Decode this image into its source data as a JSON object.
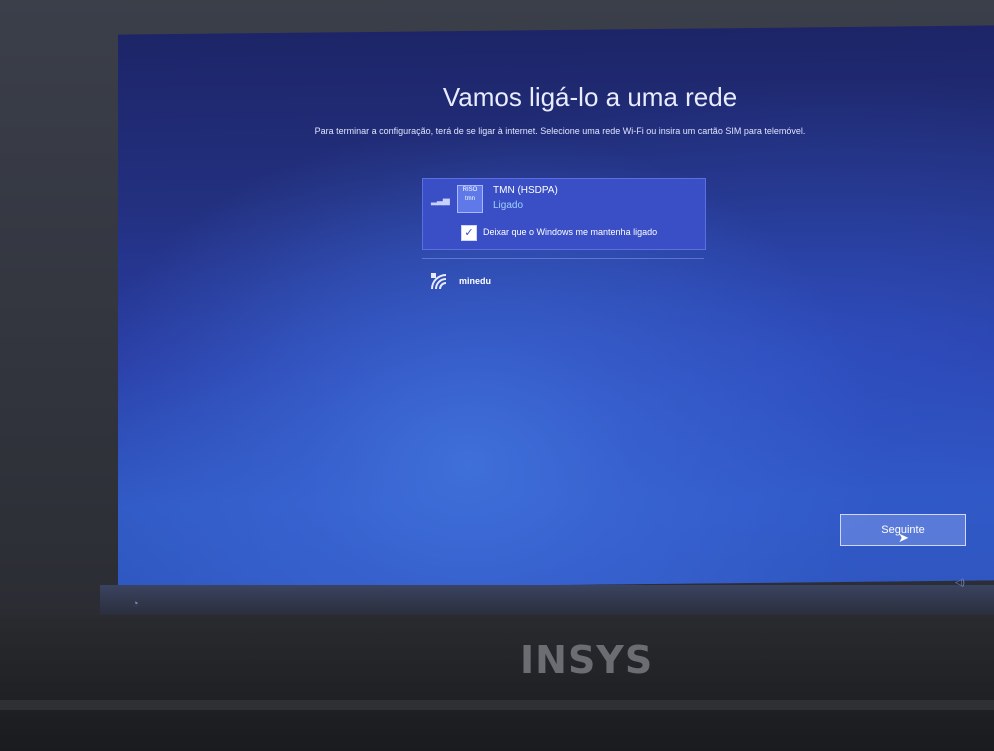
{
  "page": {
    "title": "Vamos ligá-lo a uma rede",
    "subtitle": "Para terminar a configuração, terá de se ligar à internet. Selecione uma rede Wi-Fi ou insira um cartão SIM para telemóvel."
  },
  "networks": {
    "selected": {
      "name": "TMN (HSDPA)",
      "status": "Ligado",
      "sim_label_top": "RISO",
      "sim_label_bottom": "tmn",
      "keep_connected_label": "Deixar que o Windows me mantenha ligado",
      "keep_connected_checked": true
    },
    "others": [
      {
        "name": "minedu",
        "icon": "wifi-secured-icon"
      }
    ]
  },
  "footer": {
    "next_label": "Seguinte"
  },
  "hardware": {
    "brand": "INSYS"
  },
  "colors": {
    "accent": "#3a4fc6",
    "status_text": "#9fd0ff"
  }
}
